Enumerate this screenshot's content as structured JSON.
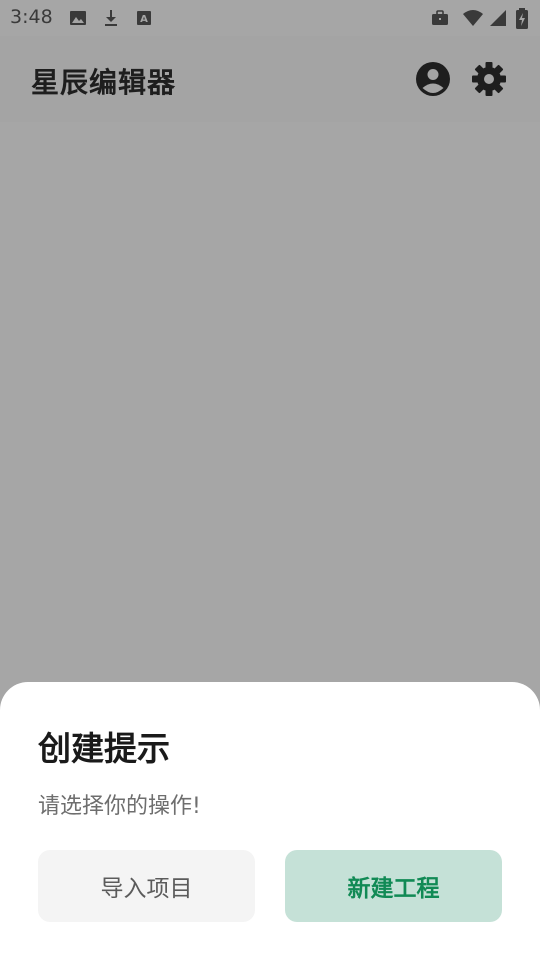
{
  "status_bar": {
    "time": "3:48",
    "left_icons": [
      "image-icon",
      "download-icon",
      "text-a-icon"
    ],
    "right_icons": [
      "briefcase-icon",
      "wifi-icon",
      "signal-icon",
      "battery-icon"
    ]
  },
  "app_bar": {
    "title": "星辰编辑器",
    "actions": [
      "account-icon",
      "settings-gear-icon"
    ]
  },
  "sheet": {
    "title": "创建提示",
    "message": "请选择你的操作!",
    "import_label": "导入项目",
    "new_label": "新建工程"
  },
  "colors": {
    "scrim": "#a6a6a6",
    "accent_bg": "#c5e1d7",
    "accent_text": "#118a55",
    "secondary_bg": "#f4f4f4"
  }
}
